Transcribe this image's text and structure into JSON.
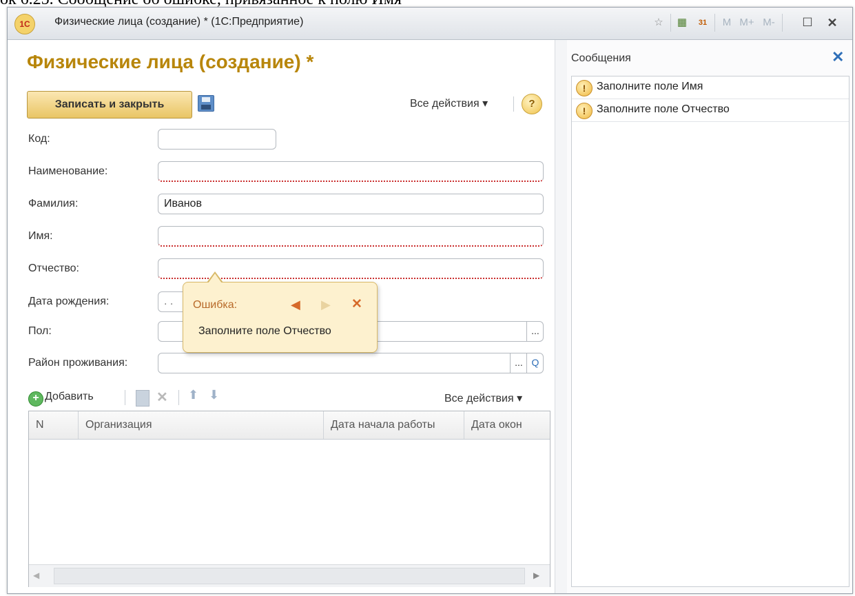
{
  "page_caption": "ок 6.25. Сообщение об ошибке, привязанное к полю Имя",
  "window": {
    "title": "Физические лица (создание) * (1С:Предприятие)",
    "logo_text": "1С",
    "toolbar_icons": [
      "favorites-icon",
      "calculator-icon",
      "calendar-icon",
      "memory-m-icon",
      "memory-plus-icon",
      "memory-minus-icon",
      "maximize-icon",
      "close-icon"
    ],
    "memory_buttons": [
      "M",
      "M+",
      "M-"
    ],
    "calendar_day": "31"
  },
  "form": {
    "title": "Физические лица (создание) *",
    "save_close_label": "Записать и закрыть",
    "all_actions_label": "Все действия ▾",
    "help_label": "?"
  },
  "fields": {
    "code": {
      "label": "Код:",
      "value": ""
    },
    "name": {
      "label": "Наименование:",
      "value": ""
    },
    "surname": {
      "label": "Фамилия:",
      "value": "Иванов"
    },
    "first_name": {
      "label": "Имя:",
      "value": ""
    },
    "patronymic": {
      "label": "Отчество:",
      "value": ""
    },
    "birth_date": {
      "label": "Дата рождения:",
      "value": ". ."
    },
    "gender": {
      "label": "Пол:",
      "value": "",
      "choice_button": "..."
    },
    "district": {
      "label": "Район проживания:",
      "value": "",
      "choice_button": "...",
      "search_button": "Q"
    }
  },
  "table_toolbar": {
    "add_label": "Добавить",
    "add_icon": "+",
    "all_actions_label": "Все действия ▾"
  },
  "table": {
    "columns": [
      "N",
      "Организация",
      "Дата начала работы",
      "Дата окон"
    ]
  },
  "messages": {
    "title": "Сообщения",
    "close_label": "✕",
    "items": [
      {
        "icon": "!",
        "text": "Заполните поле Имя"
      },
      {
        "icon": "!",
        "text": "Заполните поле Отчество"
      }
    ]
  },
  "balloon": {
    "title": "Ошибка:",
    "text": "Заполните поле Отчество",
    "prev_label": "◀",
    "next_label": "▶",
    "close_label": "✕"
  },
  "colors": {
    "accent_title": "#b8860b",
    "error_underline": "#c92a2a",
    "balloon_bg": "#fdf1cf"
  }
}
